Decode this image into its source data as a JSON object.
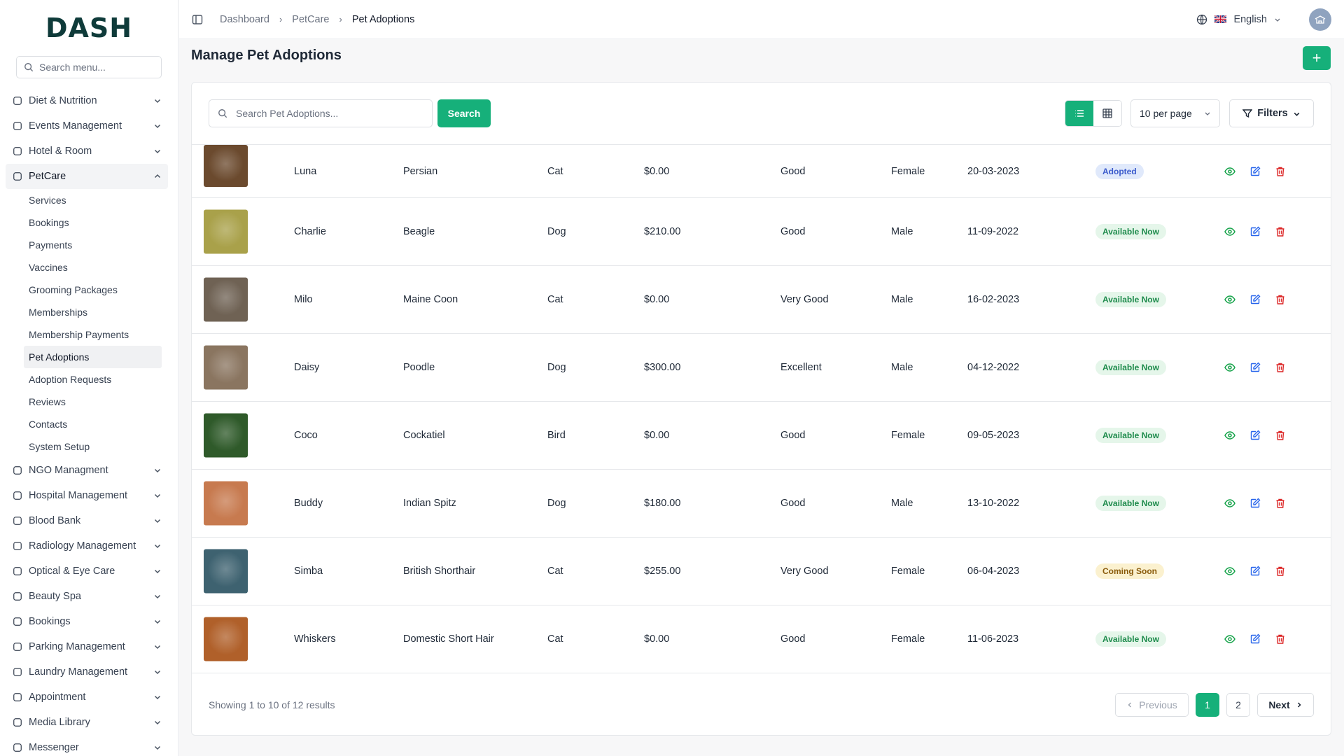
{
  "brand": {
    "logo_text": "DASH"
  },
  "sidebar": {
    "search_placeholder": "Search menu...",
    "items": [
      {
        "label": "Diet & Nutrition",
        "icon": "diet-icon"
      },
      {
        "label": "Events Management",
        "icon": "events-icon"
      },
      {
        "label": "Hotel & Room",
        "icon": "hotel-icon"
      },
      {
        "label": "PetCare",
        "icon": "petcare-icon",
        "expanded": true
      },
      {
        "label": "NGO Managment",
        "icon": "ngo-icon"
      },
      {
        "label": "Hospital Management",
        "icon": "hospital-icon"
      },
      {
        "label": "Blood Bank",
        "icon": "blood-bank-icon"
      },
      {
        "label": "Radiology Management",
        "icon": "radiology-icon"
      },
      {
        "label": "Optical & Eye Care",
        "icon": "eye-icon"
      },
      {
        "label": "Beauty Spa",
        "icon": "scissors-icon"
      },
      {
        "label": "Bookings",
        "icon": "list-icon"
      },
      {
        "label": "Parking Management",
        "icon": "parking-icon"
      },
      {
        "label": "Laundry Management",
        "icon": "laundry-icon"
      },
      {
        "label": "Appointment",
        "icon": "calendar-icon"
      },
      {
        "label": "Media Library",
        "icon": "media-icon"
      },
      {
        "label": "Messenger",
        "icon": "chat-icon"
      }
    ],
    "petcare_sub": [
      "Services",
      "Bookings",
      "Payments",
      "Vaccines",
      "Grooming Packages",
      "Memberships",
      "Membership Payments",
      "Pet Adoptions",
      "Adoption Requests",
      "Reviews",
      "Contacts",
      "System Setup"
    ],
    "active_sub": "Pet Adoptions"
  },
  "topbar": {
    "breadcrumb": [
      "Dashboard",
      "PetCare",
      "Pet Adoptions"
    ],
    "language": "English"
  },
  "page": {
    "title": "Manage Pet Adoptions",
    "add_label": "+"
  },
  "toolbar": {
    "search_placeholder": "Search Pet Adoptions...",
    "search_label": "Search",
    "per_page": "10 per page",
    "filters_label": "Filters"
  },
  "rows": [
    {
      "name": "Luna",
      "breed": "Persian",
      "type": "Cat",
      "price": "$0.00",
      "health": "Good",
      "gender": "Female",
      "date": "20-03-2023",
      "status": "Adopted",
      "status_kind": "adopted",
      "thumb_color": "#6b4a2e"
    },
    {
      "name": "Charlie",
      "breed": "Beagle",
      "type": "Dog",
      "price": "$210.00",
      "health": "Good",
      "gender": "Male",
      "date": "11-09-2022",
      "status": "Available Now",
      "status_kind": "available",
      "thumb_color": "#a9a14a"
    },
    {
      "name": "Milo",
      "breed": "Maine Coon",
      "type": "Cat",
      "price": "$0.00",
      "health": "Very Good",
      "gender": "Male",
      "date": "16-02-2023",
      "status": "Available Now",
      "status_kind": "available",
      "thumb_color": "#6f6254"
    },
    {
      "name": "Daisy",
      "breed": "Poodle",
      "type": "Dog",
      "price": "$300.00",
      "health": "Excellent",
      "gender": "Male",
      "date": "04-12-2022",
      "status": "Available Now",
      "status_kind": "available",
      "thumb_color": "#8a7560"
    },
    {
      "name": "Coco",
      "breed": "Cockatiel",
      "type": "Bird",
      "price": "$0.00",
      "health": "Good",
      "gender": "Female",
      "date": "09-05-2023",
      "status": "Available Now",
      "status_kind": "available",
      "thumb_color": "#2f5a2a"
    },
    {
      "name": "Buddy",
      "breed": "Indian Spitz",
      "type": "Dog",
      "price": "$180.00",
      "health": "Good",
      "gender": "Male",
      "date": "13-10-2022",
      "status": "Available Now",
      "status_kind": "available",
      "thumb_color": "#c77a4f"
    },
    {
      "name": "Simba",
      "breed": "British Shorthair",
      "type": "Cat",
      "price": "$255.00",
      "health": "Very Good",
      "gender": "Female",
      "date": "06-04-2023",
      "status": "Coming Soon",
      "status_kind": "soon",
      "thumb_color": "#3e6270"
    },
    {
      "name": "Whiskers",
      "breed": "Domestic Short Hair",
      "type": "Cat",
      "price": "$0.00",
      "health": "Good",
      "gender": "Female",
      "date": "11-06-2023",
      "status": "Available Now",
      "status_kind": "available",
      "thumb_color": "#b0602a"
    }
  ],
  "footer": {
    "results_text": "Showing 1 to 10 of 12 results",
    "prev_label": "Previous",
    "pages": [
      "1",
      "2"
    ],
    "current_page": "1",
    "next_label": "Next"
  },
  "colors": {
    "accent": "#16b07a",
    "adopted": "#3b5bcc",
    "available": "#1e8b4c",
    "soon": "#8a5b0b"
  }
}
